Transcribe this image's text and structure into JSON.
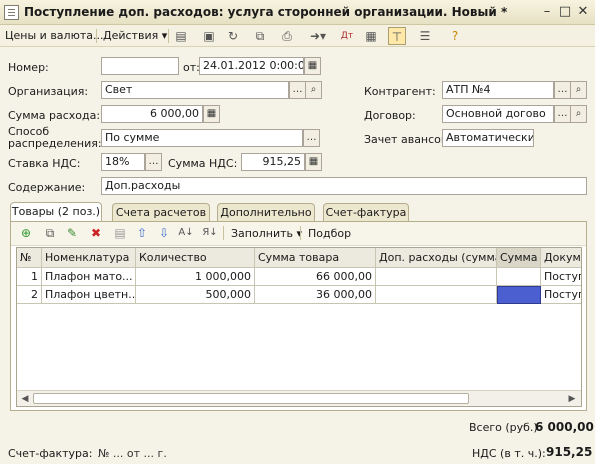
{
  "window": {
    "title": "Поступление доп. расходов: услуга сторонней организации. Новый *",
    "controls": {
      "minimize": "–",
      "maximize": "□",
      "close": "✕"
    }
  },
  "toolbar": {
    "prices_label": "Цены и валюта...",
    "actions_label": "Действия ▾"
  },
  "form": {
    "number_label": "Номер:",
    "number_value": "",
    "date_label": "от:",
    "date_value": "24.01.2012  0:00:00",
    "org_label": "Организация:",
    "org_value": "Свет",
    "counterparty_label": "Контрагент:",
    "counterparty_value": "АТП №4",
    "amount_label": "Сумма расхода:",
    "amount_value": "6 000,00",
    "contract_label": "Договор:",
    "contract_value": "Основной догово",
    "method_label": "Способ распределения:",
    "method_value": "По сумме",
    "advance_label": "Зачет авансов:",
    "advance_value": "Автоматически",
    "vat_rate_label": "Ставка НДС:",
    "vat_rate_value": "18%",
    "vat_sum_label": "Сумма НДС:",
    "vat_sum_value": "915,25",
    "content_label": "Содержание:",
    "content_value": "Доп.расходы"
  },
  "tabs": [
    {
      "label": "Товары (2 поз.)",
      "active": true
    },
    {
      "label": "Счета расчетов"
    },
    {
      "label": "Дополнительно"
    },
    {
      "label": "Счет-фактура"
    }
  ],
  "table_toolbar": {
    "fill_label": "Заполнить ▾",
    "select_label": "Подбор"
  },
  "grid": {
    "columns": [
      "№",
      "Номенклатура",
      "Количество",
      "Сумма товара",
      "Доп. расходы (сумма)",
      "Сумма",
      "Докуме"
    ],
    "rows": [
      [
        "1",
        "Плафон мато...",
        "1 000,000",
        "66 000,00",
        "",
        "",
        "Поступ"
      ],
      [
        "2",
        "Плафон цветн...",
        "500,000",
        "36 000,00",
        "",
        "",
        "Поступ"
      ]
    ]
  },
  "footer": {
    "total_label": "Всего (руб.):",
    "total_value": "6 000,00",
    "vat_label": "НДС (в т. ч.):",
    "vat_value": "915,25",
    "invoice_label": "Счет-фактура:",
    "invoice_value": "№ ... от ... г."
  },
  "colors": {
    "selection": "#4c5fd0",
    "title_bg": "#ece6c8"
  }
}
